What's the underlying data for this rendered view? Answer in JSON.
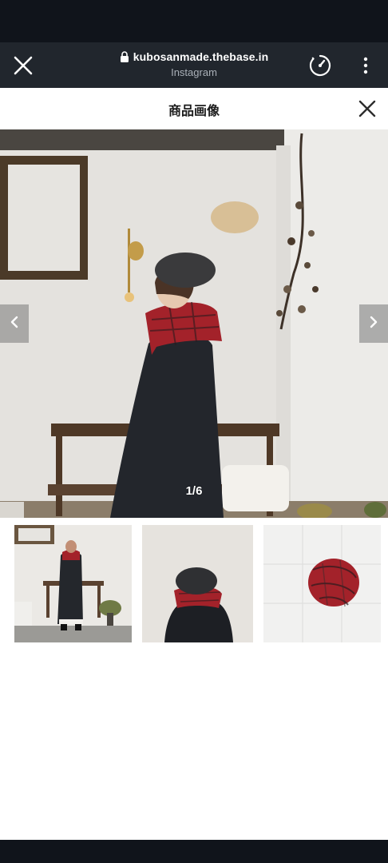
{
  "browser": {
    "url": "kubosanmade.thebase.in",
    "source": "Instagram",
    "close_icon": "close-icon",
    "lock_icon": "lock-icon",
    "speed_icon": "speedometer-icon",
    "more_icon": "more-vertical-icon"
  },
  "page": {
    "title": "商品画像",
    "close_icon": "close-icon"
  },
  "gallery": {
    "counter": "1/6",
    "prev_icon": "chevron-left-icon",
    "next_icon": "chevron-right-icon",
    "main_image": "woman in black beret, red tartan scarf and dark coat standing by a wooden bench",
    "thumbnails": [
      {
        "image": "full-length view of model in dark coat and tartan scarf"
      },
      {
        "image": "back view of model wearing beret and tartan scarf"
      },
      {
        "image": "red tartan scarf coiled on white tiles"
      }
    ]
  },
  "colors": {
    "status_bar": "#10141b",
    "browser_bar": "#21262d",
    "accent_scarf": "#a3222a"
  }
}
